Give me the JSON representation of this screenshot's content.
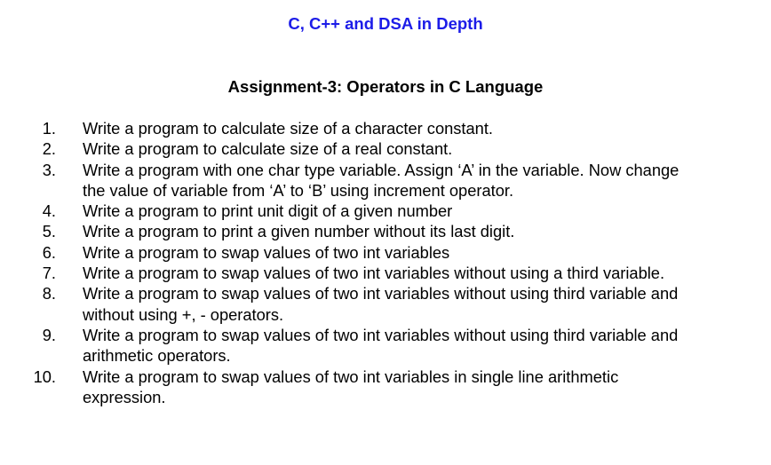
{
  "header": {
    "course_title": "C, C++ and DSA in Depth",
    "assignment_title": "Assignment-3: Operators in C Language"
  },
  "tasks": [
    {
      "number": "1.",
      "lines": [
        "Write a program to calculate size of a character constant."
      ]
    },
    {
      "number": "2.",
      "lines": [
        "Write a program to calculate size of a real constant."
      ]
    },
    {
      "number": "3.",
      "lines": [
        "Write a program with one char type variable. Assign ‘A’ in the variable. Now change",
        "the value of variable from ‘A’ to ‘B’ using increment operator."
      ]
    },
    {
      "number": "4.",
      "lines": [
        "Write a program to print unit digit of a given number"
      ]
    },
    {
      "number": "5.",
      "lines": [
        "Write a program to print a given number without its last digit."
      ]
    },
    {
      "number": "6.",
      "lines": [
        "Write a program to swap values of two int variables"
      ]
    },
    {
      "number": "7.",
      "lines": [
        "Write a program to swap values of two int variables without using a third variable."
      ]
    },
    {
      "number": "8.",
      "lines": [
        "Write a program to swap values of two int variables without using third variable and",
        "without using +, - operators."
      ]
    },
    {
      "number": "9.",
      "lines": [
        "Write a program to swap values of two int variables without using third variable and",
        "arithmetic operators."
      ]
    },
    {
      "number": "10.",
      "lines": [
        "Write a program to swap values of two int variables in single line arithmetic",
        "expression."
      ]
    }
  ]
}
